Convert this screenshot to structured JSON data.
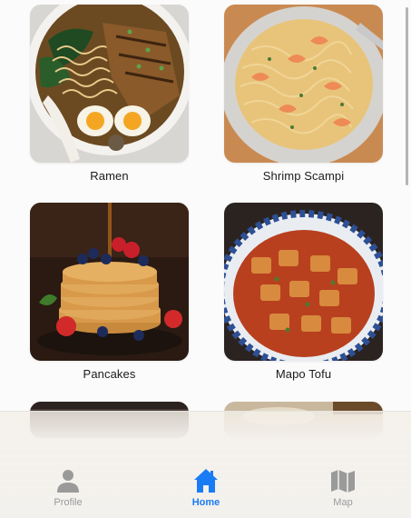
{
  "recipes": [
    {
      "name": "Ramen"
    },
    {
      "name": "Shrimp Scampi"
    },
    {
      "name": "Pancakes"
    },
    {
      "name": "Mapo Tofu"
    }
  ],
  "tabbar": {
    "tabs": [
      {
        "label": "Profile",
        "icon": "person-icon",
        "active": false
      },
      {
        "label": "Home",
        "icon": "house-icon",
        "active": true
      },
      {
        "label": "Map",
        "icon": "map-icon",
        "active": false
      }
    ],
    "active_color": "#1a7cf5",
    "inactive_color": "#9a9a9a"
  }
}
